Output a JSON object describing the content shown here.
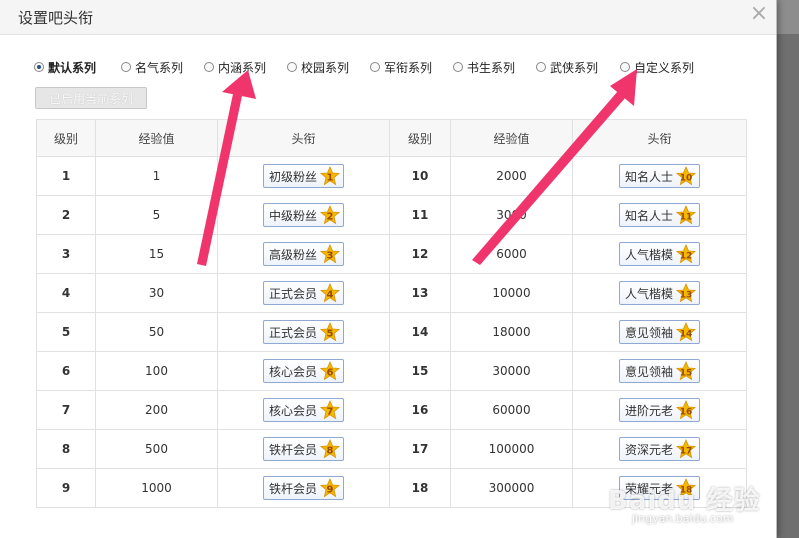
{
  "dialog": {
    "title": "设置吧头衔",
    "close_icon": "×"
  },
  "series": [
    {
      "label": "默认系列",
      "selected": true
    },
    {
      "label": "名气系列",
      "selected": false
    },
    {
      "label": "内涵系列",
      "selected": false
    },
    {
      "label": "校园系列",
      "selected": false
    },
    {
      "label": "军衔系列",
      "selected": false
    },
    {
      "label": "书生系列",
      "selected": false
    },
    {
      "label": "武侠系列",
      "selected": false
    },
    {
      "label": "自定义系列",
      "selected": false
    }
  ],
  "enabled_button": "已启用当前系列",
  "table": {
    "headers": [
      "级别",
      "经验值",
      "头衔",
      "级别",
      "经验值",
      "头衔"
    ],
    "rows": [
      {
        "l1": "1",
        "e1": "1",
        "t1": "初级粉丝",
        "b1": "1",
        "l2": "10",
        "e2": "2000",
        "t2": "知名人士",
        "b2": "10"
      },
      {
        "l1": "2",
        "e1": "5",
        "t1": "中级粉丝",
        "b1": "2",
        "l2": "11",
        "e2": "3000",
        "t2": "知名人士",
        "b2": "11"
      },
      {
        "l1": "3",
        "e1": "15",
        "t1": "高级粉丝",
        "b1": "3",
        "l2": "12",
        "e2": "6000",
        "t2": "人气楷模",
        "b2": "12"
      },
      {
        "l1": "4",
        "e1": "30",
        "t1": "正式会员",
        "b1": "4",
        "l2": "13",
        "e2": "10000",
        "t2": "人气楷模",
        "b2": "13"
      },
      {
        "l1": "5",
        "e1": "50",
        "t1": "正式会员",
        "b1": "5",
        "l2": "14",
        "e2": "18000",
        "t2": "意见领袖",
        "b2": "14"
      },
      {
        "l1": "6",
        "e1": "100",
        "t1": "核心会员",
        "b1": "6",
        "l2": "15",
        "e2": "30000",
        "t2": "意见领袖",
        "b2": "15"
      },
      {
        "l1": "7",
        "e1": "200",
        "t1": "核心会员",
        "b1": "7",
        "l2": "16",
        "e2": "60000",
        "t2": "进阶元老",
        "b2": "16"
      },
      {
        "l1": "8",
        "e1": "500",
        "t1": "铁杆会员",
        "b1": "8",
        "l2": "17",
        "e2": "100000",
        "t2": "资深元老",
        "b2": "17"
      },
      {
        "l1": "9",
        "e1": "1000",
        "t1": "铁杆会员",
        "b1": "9",
        "l2": "18",
        "e2": "300000",
        "t2": "荣耀元老",
        "b2": "18"
      }
    ]
  },
  "watermark": {
    "text": "Baidu 经验",
    "url": "jingyan.baidu.com"
  },
  "colors": {
    "arrow": "#f0356c",
    "accent": "#2a4f86",
    "badge_border": "#8fa9d4",
    "star": "#f5b800"
  }
}
